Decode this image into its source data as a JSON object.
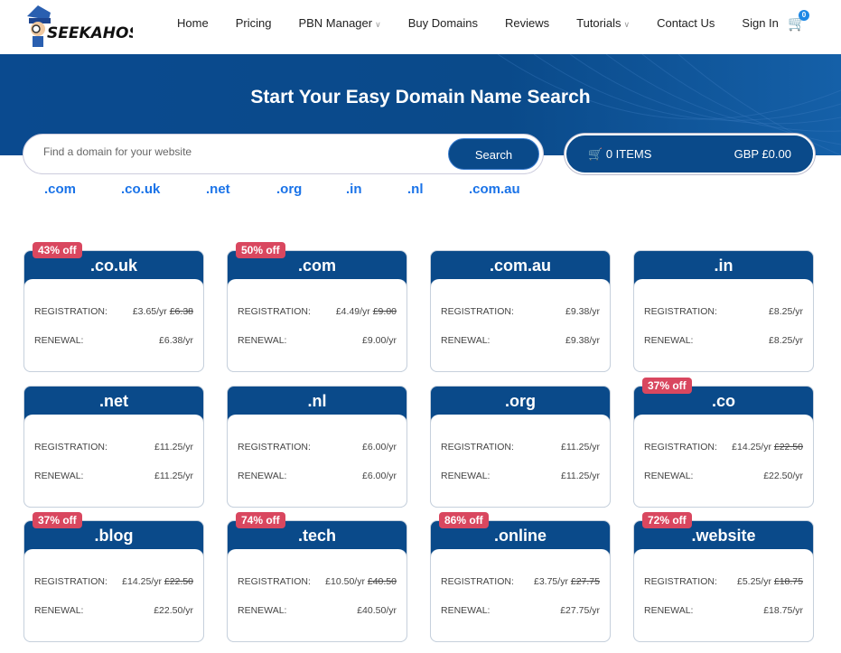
{
  "brand": {
    "logo_text": "SEEKAHOST"
  },
  "nav": {
    "items": [
      {
        "label": "Home"
      },
      {
        "label": "Pricing"
      },
      {
        "label": "PBN Manager",
        "dropdown": true
      },
      {
        "label": "Buy Domains"
      },
      {
        "label": "Reviews"
      },
      {
        "label": "Tutorials",
        "dropdown": true
      },
      {
        "label": "Contact Us"
      },
      {
        "label": "Sign In"
      }
    ],
    "cart_count": "0"
  },
  "hero": {
    "title": "Start Your Easy Domain Name Search"
  },
  "search": {
    "placeholder": "Find a domain for your website",
    "button": "Search"
  },
  "cart": {
    "items": "0 ITEMS",
    "total": "GBP £0.00"
  },
  "quick_tlds": [
    ".com",
    ".co.uk",
    ".net",
    ".org",
    ".in",
    ".nl",
    ".com.au"
  ],
  "labels": {
    "registration": "REGISTRATION:",
    "renewal": "RENEWAL:"
  },
  "colors": {
    "primary": "#0a4a8a",
    "discount": "#d9475f",
    "link": "#1a73e8"
  },
  "domains": [
    {
      "tld": ".co.uk",
      "discount": "43% off",
      "reg": "£3.65/yr",
      "old": "£6.38",
      "renew": "£6.38/yr"
    },
    {
      "tld": ".com",
      "discount": "50% off",
      "reg": "£4.49/yr",
      "old": "£9.00",
      "renew": "£9.00/yr"
    },
    {
      "tld": ".com.au",
      "reg": "£9.38/yr",
      "renew": "£9.38/yr"
    },
    {
      "tld": ".in",
      "reg": "£8.25/yr",
      "renew": "£8.25/yr"
    },
    {
      "tld": ".net",
      "reg": "£11.25/yr",
      "renew": "£11.25/yr"
    },
    {
      "tld": ".nl",
      "reg": "£6.00/yr",
      "renew": "£6.00/yr"
    },
    {
      "tld": ".org",
      "reg": "£11.25/yr",
      "renew": "£11.25/yr"
    },
    {
      "tld": ".co",
      "discount": "37% off",
      "reg": "£14.25/yr",
      "old": "£22.50",
      "renew": "£22.50/yr"
    },
    {
      "tld": ".blog",
      "discount": "37% off",
      "reg": "£14.25/yr",
      "old": "£22.50",
      "renew": "£22.50/yr"
    },
    {
      "tld": ".tech",
      "discount": "74% off",
      "reg": "£10.50/yr",
      "old": "£40.50",
      "renew": "£40.50/yr"
    },
    {
      "tld": ".online",
      "discount": "86% off",
      "reg": "£3.75/yr",
      "old": "£27.75",
      "renew": "£27.75/yr"
    },
    {
      "tld": ".website",
      "discount": "72% off",
      "reg": "£5.25/yr",
      "old": "£18.75",
      "renew": "£18.75/yr"
    }
  ]
}
